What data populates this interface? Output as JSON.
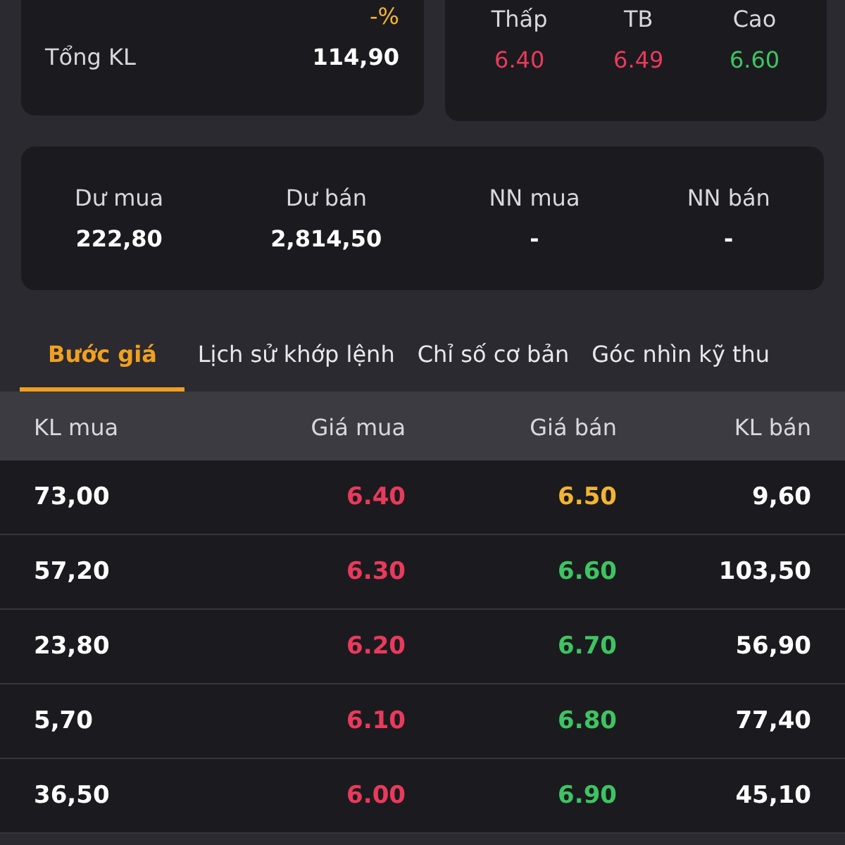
{
  "summary": {
    "change_percent": "-%",
    "total_volume_label": "Tổng KL",
    "total_volume": "114,90"
  },
  "price_range": [
    {
      "label": "Thấp",
      "value": "6.40",
      "color": "#ea3a5c"
    },
    {
      "label": "TB",
      "value": "6.49",
      "color": "#ea3a5c"
    },
    {
      "label": "Cao",
      "value": "6.60",
      "color": "#3ec462"
    }
  ],
  "balances": [
    {
      "label": "Dư mua",
      "value": "222,80"
    },
    {
      "label": "Dư bán",
      "value": "2,814,50"
    },
    {
      "label": "NN mua",
      "value": "-"
    },
    {
      "label": "NN bán",
      "value": "-"
    }
  ],
  "tabs": [
    {
      "label": "Bước giá",
      "selected": true
    },
    {
      "label": "Lịch sử khớp lệnh",
      "selected": false
    },
    {
      "label": "Chỉ số cơ bản",
      "selected": false
    },
    {
      "label": "Góc nhìn kỹ thu",
      "selected": false
    }
  ],
  "table": {
    "columns": [
      "KL mua",
      "Giá mua",
      "Giá bán",
      "KL bán"
    ],
    "rows": [
      {
        "bid_volume": "73,00",
        "bid_price": {
          "value": "6.40",
          "color": "#ea3a5c"
        },
        "ask_price": {
          "value": "6.50",
          "color": "#f2b431"
        },
        "ask_volume": "9,60"
      },
      {
        "bid_volume": "57,20",
        "bid_price": {
          "value": "6.30",
          "color": "#ea3a5c"
        },
        "ask_price": {
          "value": "6.60",
          "color": "#3ec462"
        },
        "ask_volume": "103,50"
      },
      {
        "bid_volume": "23,80",
        "bid_price": {
          "value": "6.20",
          "color": "#ea3a5c"
        },
        "ask_price": {
          "value": "6.70",
          "color": "#3ec462"
        },
        "ask_volume": "56,90"
      },
      {
        "bid_volume": "5,70",
        "bid_price": {
          "value": "6.10",
          "color": "#ea3a5c"
        },
        "ask_price": {
          "value": "6.80",
          "color": "#3ec462"
        },
        "ask_volume": "77,40"
      },
      {
        "bid_volume": "36,50",
        "bid_price": {
          "value": "6.00",
          "color": "#ea3a5c"
        },
        "ask_price": {
          "value": "6.90",
          "color": "#3ec462"
        },
        "ask_volume": "45,10"
      }
    ]
  }
}
